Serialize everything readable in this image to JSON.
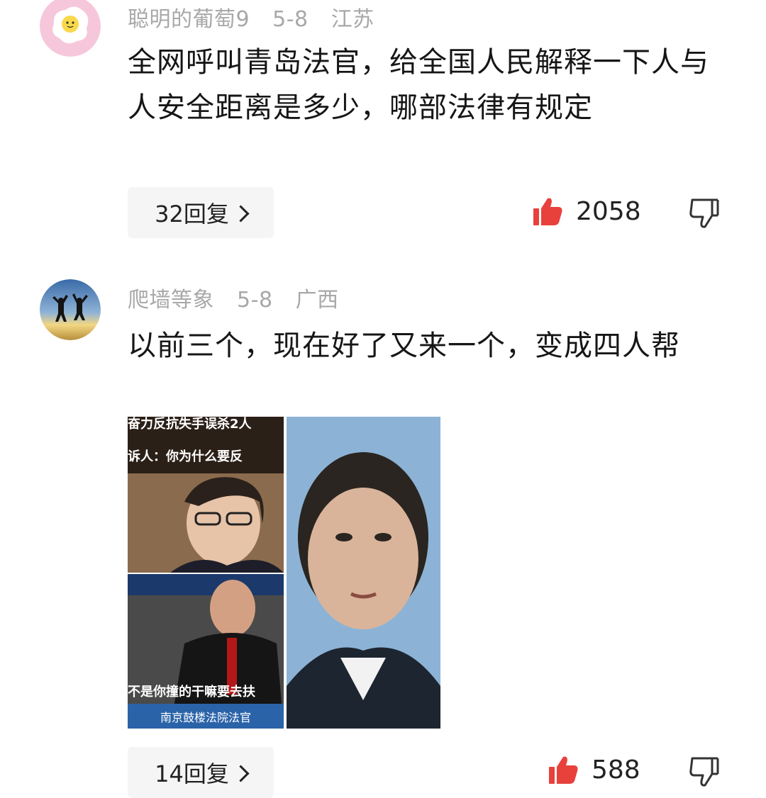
{
  "comments": [
    {
      "username": "聪明的葡萄9",
      "date": "5-8",
      "location": "江苏",
      "text": "全网呼叫青岛法官，给全国人民解释一下人与人安全距离是多少，哪部法律有规定",
      "reply_label": "32回复",
      "likes": "2058",
      "avatar_icon": "fried-egg-smiley-avatar"
    },
    {
      "username": "爬墙等象",
      "date": "5-8",
      "location": "广西",
      "text": "以前三个，现在好了又来一个，变成四人帮",
      "reply_label": "14回复",
      "likes": "588",
      "avatar_icon": "jumping-silhouettes-avatar",
      "image": {
        "caption_top_1": "奋力反抗失手误杀2人",
        "caption_top_2": "诉人：你为什么要反",
        "caption_bottom": "不是你撞的干嘛要去扶",
        "caption_footer": "南京鼓楼法院法官"
      }
    }
  ],
  "colors": {
    "like_red": "#e8413c",
    "meta_gray": "#a8a8a8",
    "text_dark": "#161616",
    "reply_bg": "#f5f5f5"
  }
}
